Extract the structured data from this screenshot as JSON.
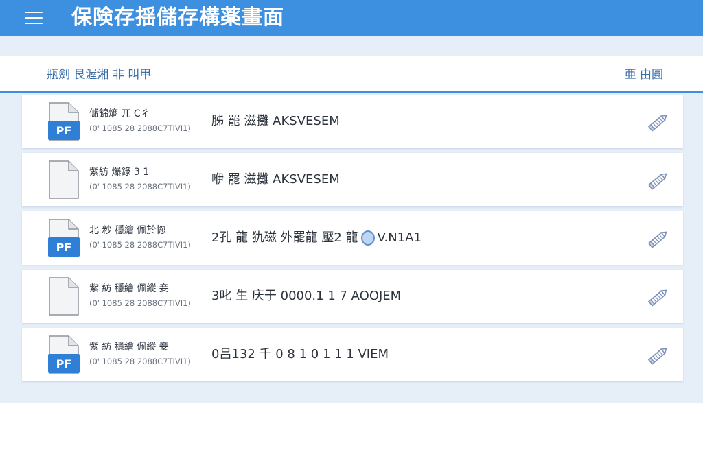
{
  "app_bar": {
    "title": "保険存揺儲存構薬畫面",
    "menu_icon": "hamburger-icon",
    "color": "#3d8fe0"
  },
  "sub_header": {
    "left_label": "瓶劍 艮渥湘 非 叫甲",
    "right_label": "亜 由圓"
  },
  "files": [
    {
      "name": "儲錦熵 兀 C彳",
      "meta": "(0' 1085 28 2088C7TIVI1)",
      "status": "胏 罷 滋攤 AKSVESEM",
      "icon": "pdf-file-icon",
      "badge": "PF",
      "sync_icon": false
    },
    {
      "name": "紫紡 爆錄 3 1",
      "meta": "(0' 1085 28 2088C7TIVI1)",
      "status": "咿 罷 滋攤 AKSVESEM",
      "icon": "blank-file-icon",
      "badge": "",
      "sync_icon": false
    },
    {
      "name": "北 粆 穩繪 佩於惚",
      "meta": "(0' 1085 28 2088C7TIVI1)",
      "status": "2孔 龍 犰磁 外罷龍 壓2 龍",
      "status_suffix": "V.N1A1",
      "icon": "pdf-file-icon",
      "badge": "PF",
      "sync_icon": true
    },
    {
      "name": "紫 紡 穩繪 佩縦 妾",
      "meta": "(0' 1085 28 2088C7TIVI1)",
      "status": "3叱 生 庆于 0000.1 1 7 AOOJEM",
      "icon": "blank-file-icon",
      "badge": "",
      "sync_icon": false
    },
    {
      "name": "紫 紡 穩繪 佩縦 妾",
      "meta": "(0' 1085 28 2088C7TIVI1)",
      "status": "0吕132 千 0 8 1 0 1 1 1 VIEM",
      "icon": "pdf-file-icon",
      "badge": "PF",
      "sync_icon": false
    }
  ],
  "edit_icon": "pencil-icon"
}
